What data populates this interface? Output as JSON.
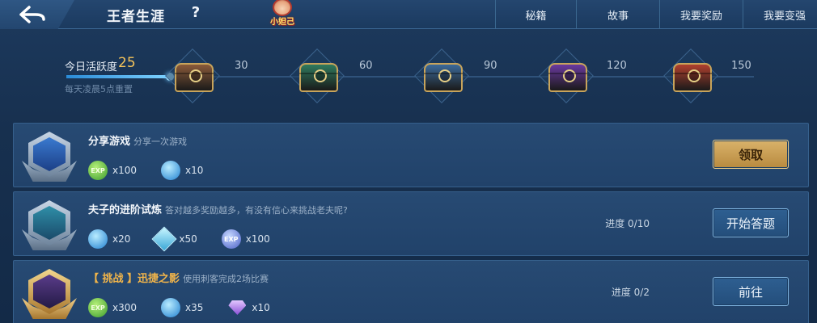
{
  "header": {
    "title": "王者生涯",
    "help": "?",
    "mascot_label": "小妲己",
    "tabs": [
      {
        "label": "秘籍"
      },
      {
        "label": "故事"
      },
      {
        "label": "我要奖励"
      },
      {
        "label": "我要变强"
      }
    ]
  },
  "activity": {
    "label": "今日活跃度",
    "value": "25",
    "reset_note": "每天凌晨5点重置",
    "progress_fraction": 0.167,
    "milestones": [
      {
        "value": "30",
        "color": "#8a5a3a"
      },
      {
        "value": "60",
        "color": "#2f7a5e"
      },
      {
        "value": "90",
        "color": "#3c6a9a"
      },
      {
        "value": "120",
        "color": "#6a3aa0"
      },
      {
        "value": "150",
        "color": "#b0402e"
      }
    ]
  },
  "tasks": [
    {
      "title": "分享游戏",
      "desc": "分享一次游戏",
      "rewards": [
        {
          "icon": "exp-icon",
          "icon_text": "EXP",
          "amount": "x100"
        },
        {
          "icon": "orb-icon",
          "amount": "x10"
        }
      ],
      "progress": "",
      "button": "领取"
    },
    {
      "title": "夫子的进阶试炼",
      "desc": "答对越多奖励越多，有没有信心来挑战老夫呢?",
      "rewards": [
        {
          "icon": "orb-icon",
          "amount": "x20"
        },
        {
          "icon": "crystal-icon",
          "amount": "x50"
        },
        {
          "icon": "exp-icon",
          "icon_text": "EXP",
          "amount": "x100"
        }
      ],
      "progress": "进度 0/10",
      "button": "开始答题"
    },
    {
      "title": "【 挑战 】迅捷之影",
      "desc": "使用刺客完成2场比赛",
      "rewards": [
        {
          "icon": "exp-icon",
          "icon_text": "EXP",
          "amount": "x300"
        },
        {
          "icon": "orb-icon",
          "amount": "x35"
        },
        {
          "icon": "gem-icon",
          "amount": "x10"
        }
      ],
      "progress": "进度 0/2",
      "button": "前往"
    }
  ]
}
